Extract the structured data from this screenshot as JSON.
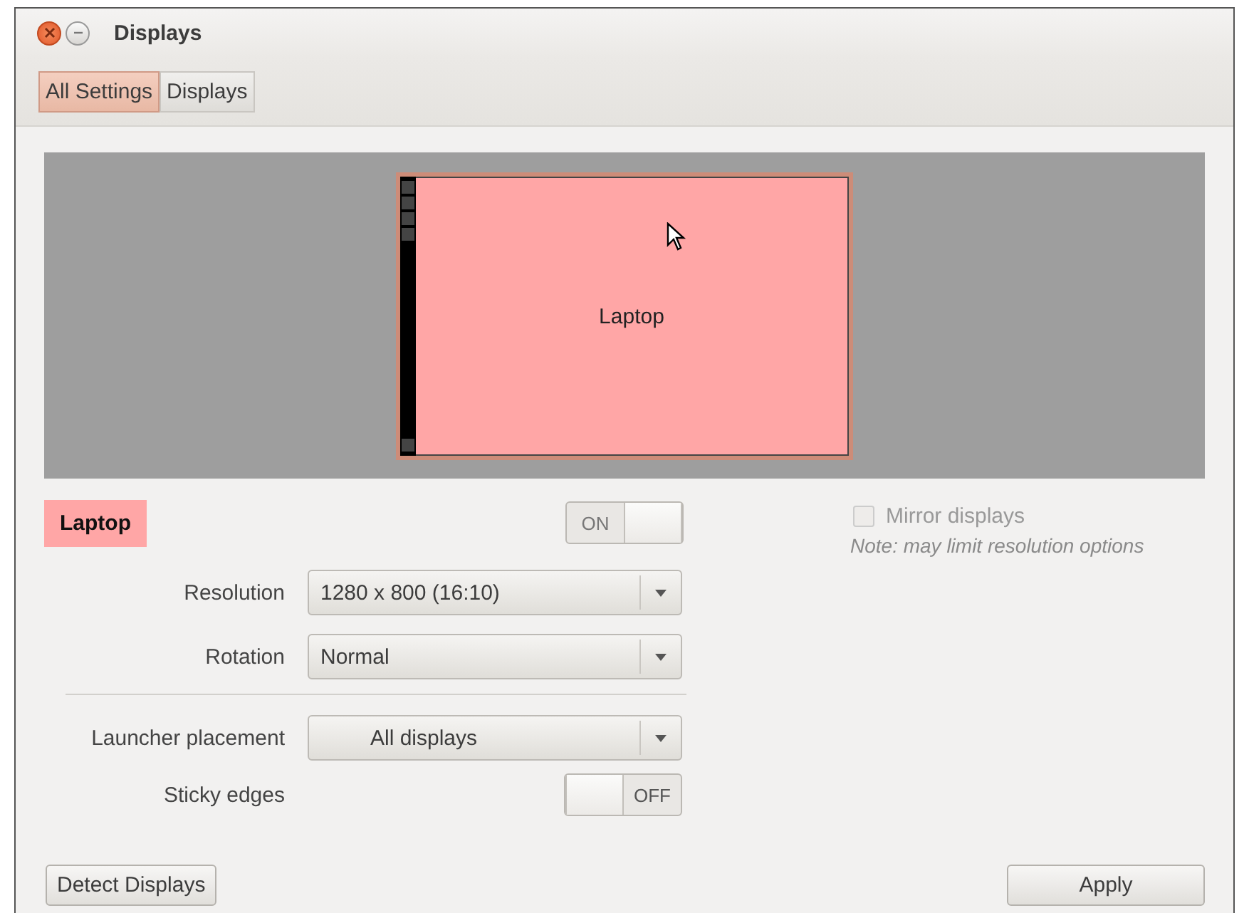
{
  "window": {
    "title": "Displays"
  },
  "breadcrumbs": [
    {
      "label": "All Settings",
      "selected": true
    },
    {
      "label": "Displays",
      "selected": false
    }
  ],
  "preview": {
    "monitor_label": "Laptop"
  },
  "display": {
    "name": "Laptop",
    "switch": {
      "on": true,
      "label": "ON"
    }
  },
  "mirror": {
    "label": "Mirror displays",
    "checked": false,
    "disabled": true,
    "note": "Note: may limit resolution options"
  },
  "display_settings": [
    {
      "label": "Resolution",
      "kind": "dropdown",
      "value": "1280 x 800 (16:10)"
    },
    {
      "label": "Rotation",
      "kind": "dropdown",
      "value": "Normal"
    }
  ],
  "launcher_settings": [
    {
      "label": "Launcher placement",
      "kind": "dropdown",
      "value": "All displays"
    },
    {
      "label": "Sticky edges",
      "kind": "switch",
      "on": false,
      "value": "OFF"
    }
  ],
  "buttons": {
    "detect": "Detect Displays",
    "apply": "Apply"
  }
}
